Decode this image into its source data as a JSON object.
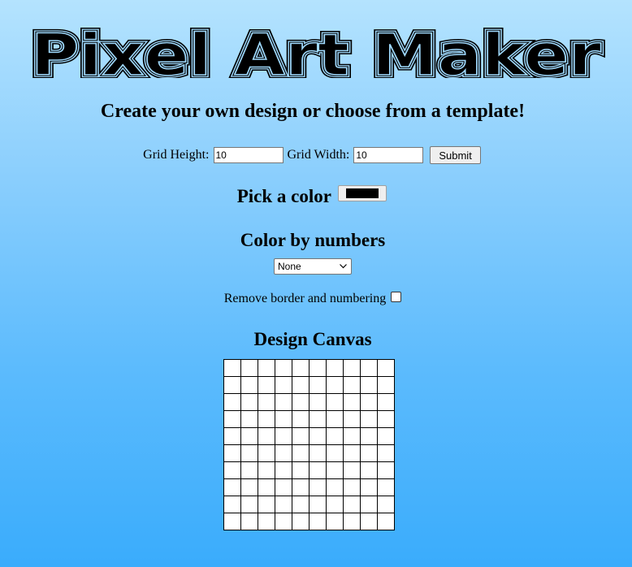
{
  "header": {
    "logo_text": "Pixel Art Maker",
    "subtitle": "Create your own design or choose from a template!"
  },
  "grid_form": {
    "height_label": "Grid Height:",
    "height_value": "10",
    "width_label": "Grid Width:",
    "width_value": "10",
    "submit_label": "Submit"
  },
  "color_picker": {
    "label": "Pick a color",
    "value": "#000000"
  },
  "color_by_numbers": {
    "title": "Color by numbers",
    "selected_option": "None"
  },
  "remove_border": {
    "label": "Remove border and numbering",
    "checked": false
  },
  "canvas": {
    "title": "Design Canvas",
    "rows": 10,
    "cols": 10,
    "cell_color": "#ffffff",
    "border_color": "#000000"
  }
}
